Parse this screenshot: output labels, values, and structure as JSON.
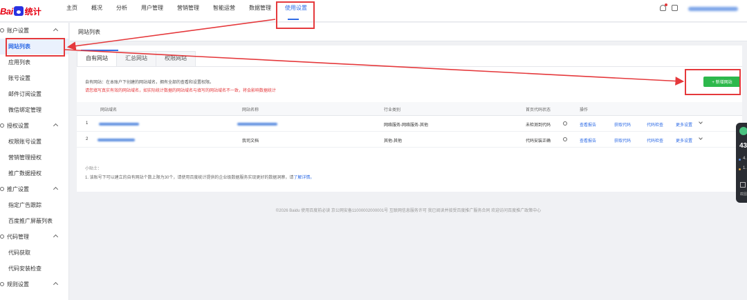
{
  "logo": {
    "bai": "Bai",
    "tongji": "统计"
  },
  "nav": [
    "主页",
    "概况",
    "分析",
    "用户管理",
    "营销管理",
    "智能运营",
    "数据管理",
    "使用设置"
  ],
  "nav_active": "使用设置",
  "sidebar": {
    "groups": [
      {
        "label": "账户设置",
        "items": [
          "网站列表",
          "应用列表",
          "账号设置",
          "邮件订阅设置",
          "微信绑定管理"
        ]
      },
      {
        "label": "授权设置",
        "items": [
          "权限账号设置",
          "营销管理授权",
          "推广数据授权"
        ]
      },
      {
        "label": "推广设置",
        "items": [
          "指定广告跟踪",
          "百度推广屏蔽列表"
        ]
      },
      {
        "label": "代码管理",
        "items": [
          "代码获取",
          "代码安装检查"
        ]
      },
      {
        "label": "规则设置",
        "items": []
      }
    ],
    "active_item": "网站列表"
  },
  "page": {
    "title": "网站列表"
  },
  "tabs": [
    "自有网站",
    "汇总网站",
    "权限网站"
  ],
  "info": {
    "line1": "自有网站：在本账户下创建的网站域名，拥有全部的查看和设置权限。",
    "line2": "请您填写真实有效的网站域名，如实际统计数据的网站域名与填写的网站域名不一致，将会影响数据统计"
  },
  "add_button": "+ 新增网站",
  "table": {
    "headers": [
      "网站域名",
      "网站名称",
      "行业类别",
      "首页代码状态",
      "操作"
    ],
    "rows": [
      {
        "index": "1",
        "name": "",
        "industry": "网络服务-网络服务-其他",
        "status": "未检测到代码",
        "actions": [
          "查看报告",
          "获取代码",
          "代码检查",
          "更多设置"
        ]
      },
      {
        "index": "2",
        "name": "我司文档",
        "industry": "其他-其他",
        "status": "代码安装正确",
        "actions": [
          "查看报告",
          "获取代码",
          "代码检查",
          "更多设置"
        ]
      }
    ]
  },
  "tips": {
    "title": "小贴士：",
    "text": "1. 该账号下可以建立的自有网站个数上限为30个，请使用百度统计提供的企业级数据服务实现更好的数据洞察，请",
    "link": "了解详情。"
  },
  "footer": "©2026 Baidu 使用百度前必读 京公网安备11000002000001号 互联网信息服务许可 我已阅读并接受百度推广服务合同 欢迎访问百度推广政策中心",
  "widget": {
    "number": "43",
    "v1": "4.",
    "v2": "1.",
    "label": "截图"
  },
  "colors": {
    "accent": "#2e6be6",
    "warning": "#e5383b",
    "add_button": "#2db84c",
    "annotation": "#e5383b"
  }
}
